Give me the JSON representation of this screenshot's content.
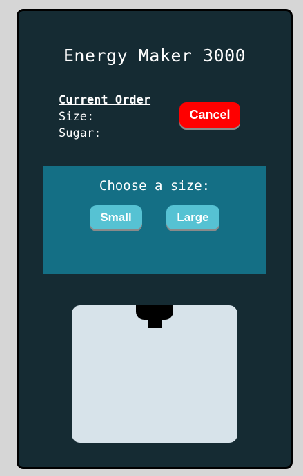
{
  "machine": {
    "title": "Energy Maker 3000"
  },
  "order": {
    "heading": "Current Order",
    "size_label": "Size:",
    "sugar_label": "Sugar:",
    "cancel_label": "Cancel"
  },
  "size_panel": {
    "prompt": "Choose a size:",
    "options": [
      "Small",
      "Large"
    ]
  },
  "colors": {
    "page_background": "#d6d6d6",
    "machine_body": "#152b33",
    "panel": "#146f85",
    "option_button": "#56c2d3",
    "cancel_button": "#ff0000",
    "dispenser_area": "#d7e3ea"
  }
}
